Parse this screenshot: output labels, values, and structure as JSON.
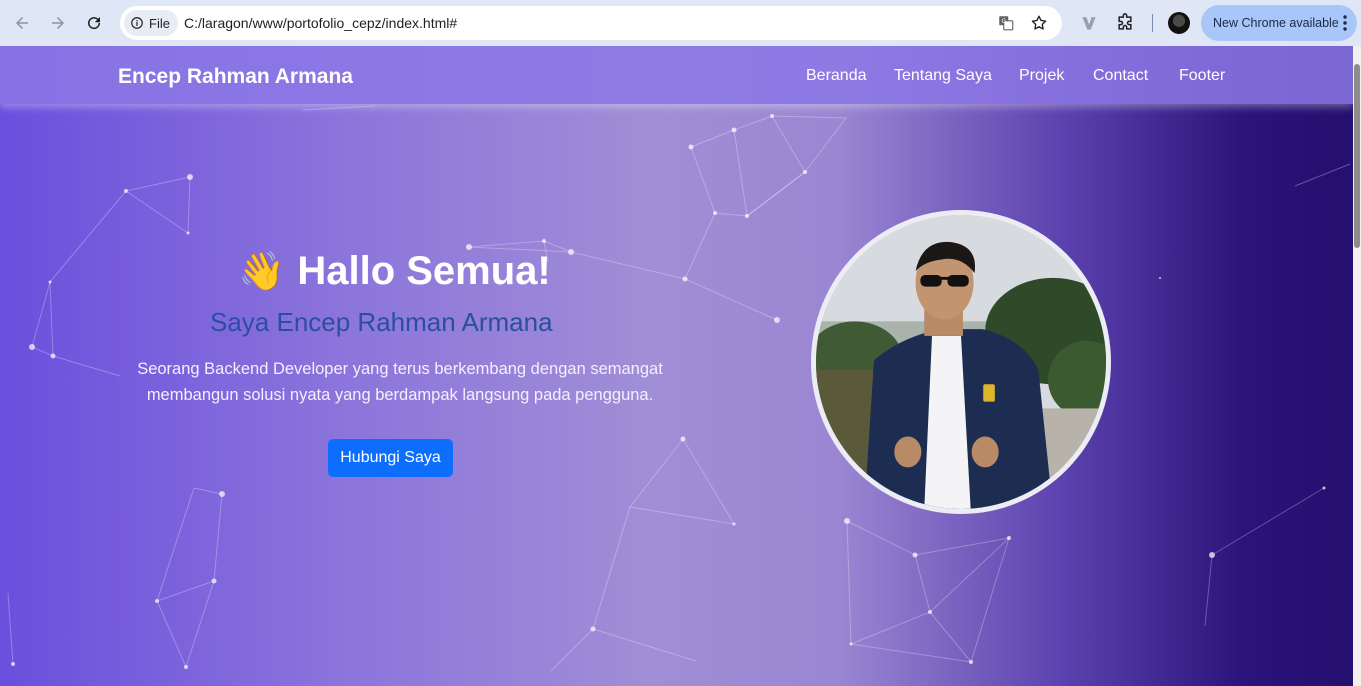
{
  "browser": {
    "site_chip_label": "File",
    "url": "C:/laragon/www/portofolio_cepz/index.html#",
    "update_label": "New Chrome available",
    "icons": {
      "back": "arrow-left-icon",
      "forward": "arrow-right-icon",
      "reload": "reload-icon",
      "info": "info-icon",
      "translate": "translate-icon",
      "bookmark": "star-icon",
      "extension_v": "v-extension-icon",
      "extensions": "puzzle-icon",
      "profile": "profile-avatar",
      "menu": "kebab-menu-icon"
    }
  },
  "navbar": {
    "brand": "Encep Rahman Armana",
    "items": [
      {
        "label": "Beranda"
      },
      {
        "label": "Tentang Saya"
      },
      {
        "label": "Projek"
      },
      {
        "label": "Contact"
      },
      {
        "label": "Footer"
      }
    ]
  },
  "hero": {
    "wave_emoji": "👋",
    "title": "Hallo Semua!",
    "subtitle": "Saya Encep Rahman Armana",
    "description": "Seorang Backend Developer yang terus berkembang dengan semangat membangun solusi nyata yang berdampak langsung pada pengguna.",
    "cta_label": "Hubungi Saya",
    "photo": "profile-photo"
  },
  "colors": {
    "cta": "#0d6efd",
    "subtitle": "#2a4fa0",
    "navbar": "#8c78e6"
  }
}
